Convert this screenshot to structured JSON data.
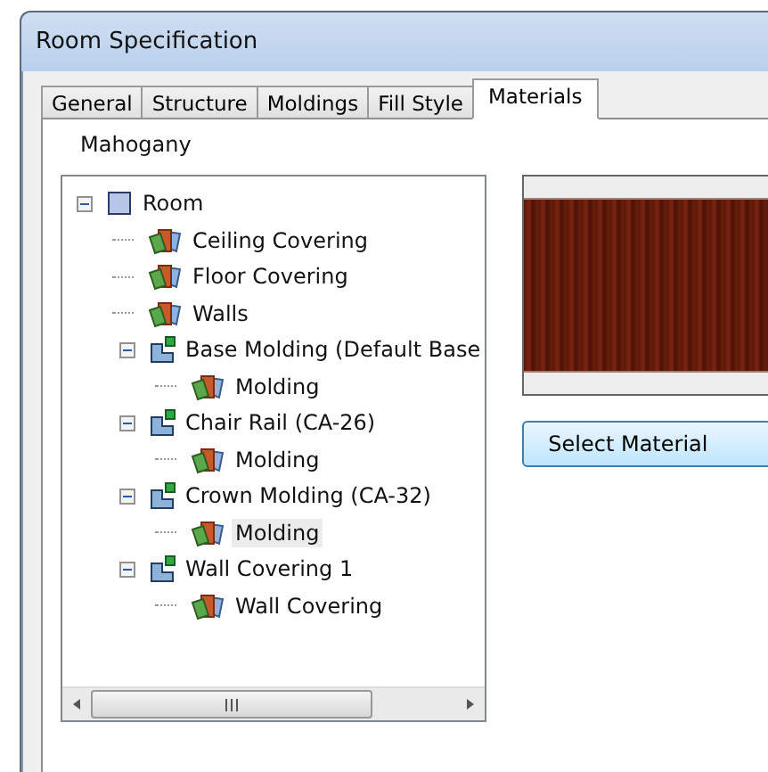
{
  "window": {
    "title": "Room Specification"
  },
  "tabs": [
    {
      "label": "General",
      "selected": false
    },
    {
      "label": "Structure",
      "selected": false
    },
    {
      "label": "Moldings",
      "selected": false
    },
    {
      "label": "Fill Style",
      "selected": false
    },
    {
      "label": "Materials",
      "selected": true
    }
  ],
  "material_name": "Mahogany",
  "tree": [
    {
      "label": "Room",
      "kind": "room",
      "expanded": true,
      "selected": false,
      "children": [
        {
          "label": "Ceiling Covering",
          "kind": "material",
          "selected": false
        },
        {
          "label": "Floor Covering",
          "kind": "material",
          "selected": false
        },
        {
          "label": "Walls",
          "kind": "material",
          "selected": false
        },
        {
          "label": "Base Molding (Default Base",
          "kind": "group",
          "expanded": true,
          "selected": false,
          "children": [
            {
              "label": "Molding",
              "kind": "material",
              "selected": false
            }
          ]
        },
        {
          "label": "Chair Rail (CA-26)",
          "kind": "group",
          "expanded": true,
          "selected": false,
          "children": [
            {
              "label": "Molding",
              "kind": "material",
              "selected": false
            }
          ]
        },
        {
          "label": "Crown Molding (CA-32)",
          "kind": "group",
          "expanded": true,
          "selected": false,
          "children": [
            {
              "label": "Molding",
              "kind": "material",
              "selected": true
            }
          ]
        },
        {
          "label": "Wall Covering 1",
          "kind": "group",
          "expanded": true,
          "selected": false,
          "children": [
            {
              "label": "Wall Covering",
              "kind": "material",
              "selected": false
            }
          ]
        }
      ]
    }
  ],
  "select_button": "Select Material"
}
